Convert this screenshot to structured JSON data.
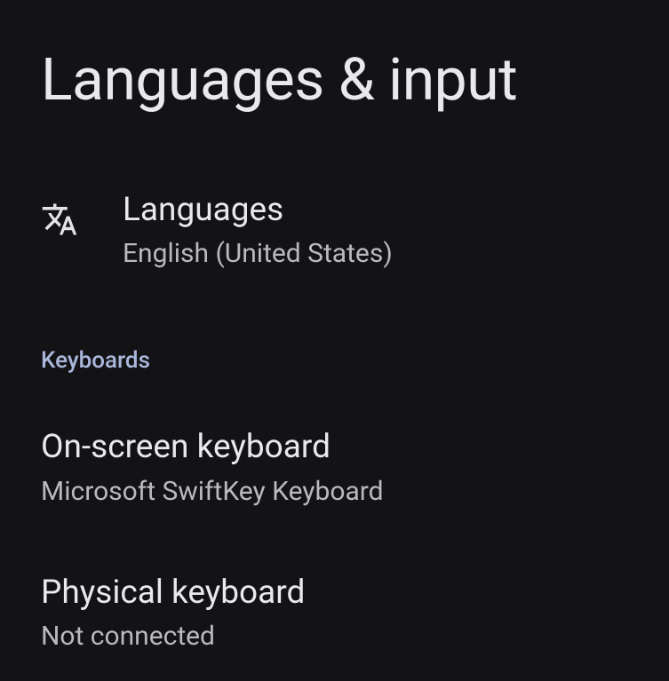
{
  "header": {
    "title": "Languages & input"
  },
  "languages": {
    "title": "Languages",
    "subtitle": "English (United States)",
    "icon": "translate-icon"
  },
  "section": {
    "keyboards_header": "Keyboards"
  },
  "onscreen": {
    "title": "On-screen keyboard",
    "subtitle": "Microsoft SwiftKey Keyboard"
  },
  "physical": {
    "title": "Physical keyboard",
    "subtitle": "Not connected"
  }
}
